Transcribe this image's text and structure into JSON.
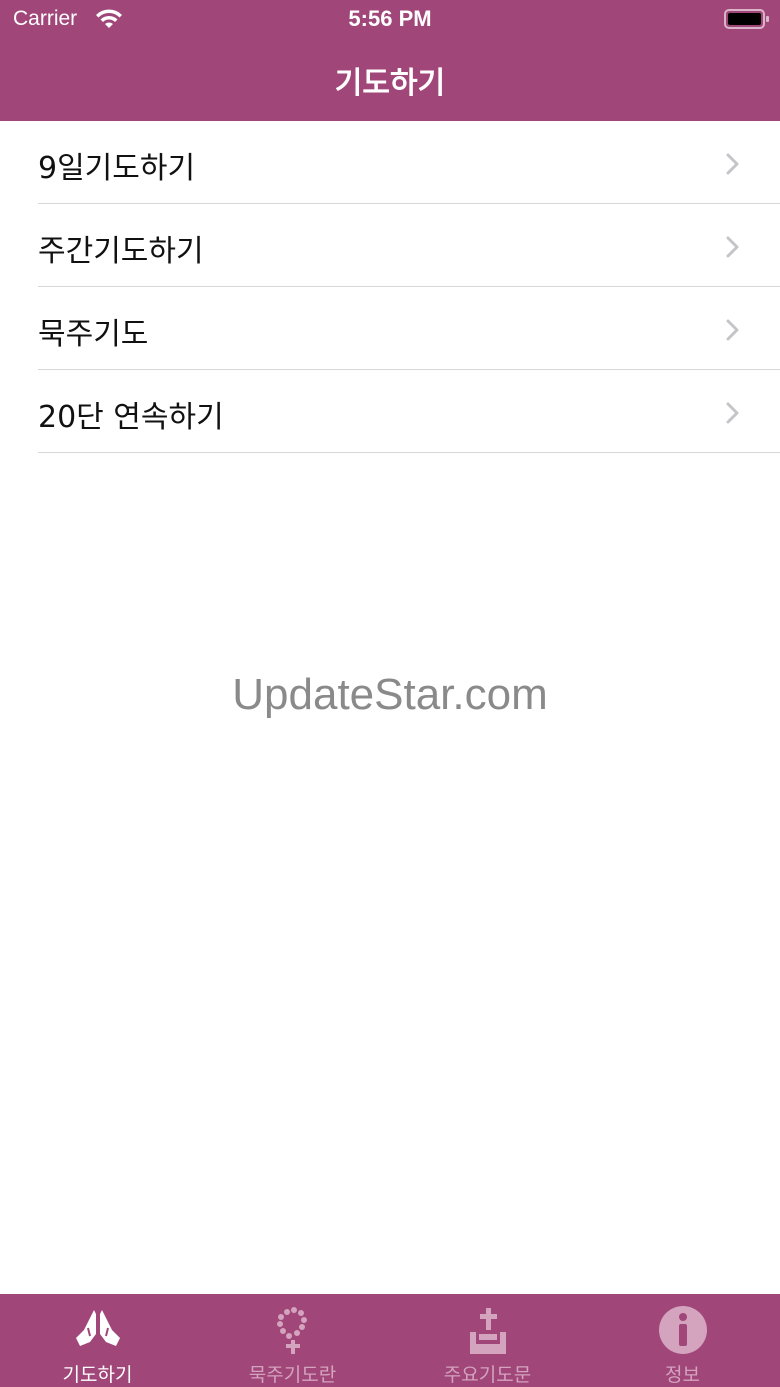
{
  "status_bar": {
    "carrier": "Carrier",
    "time": "5:56 PM"
  },
  "nav": {
    "title": "기도하기"
  },
  "list": {
    "items": [
      {
        "label": "9일기도하기"
      },
      {
        "label": "주간기도하기"
      },
      {
        "label": "묵주기도"
      },
      {
        "label": "20단 연속하기"
      }
    ]
  },
  "watermark": "UpdateStar.com",
  "tabbar": {
    "tabs": [
      {
        "label": "기도하기",
        "icon": "praying-hands-icon",
        "active": true
      },
      {
        "label": "묵주기도란",
        "icon": "rosary-icon",
        "active": false
      },
      {
        "label": "주요기도문",
        "icon": "prayer-book-cross-icon",
        "active": false
      },
      {
        "label": "정보",
        "icon": "info-icon",
        "active": false
      }
    ]
  },
  "colors": {
    "brand": "#a04679",
    "tab_inactive": "#d4a3be",
    "tab_active": "#ffffff"
  }
}
